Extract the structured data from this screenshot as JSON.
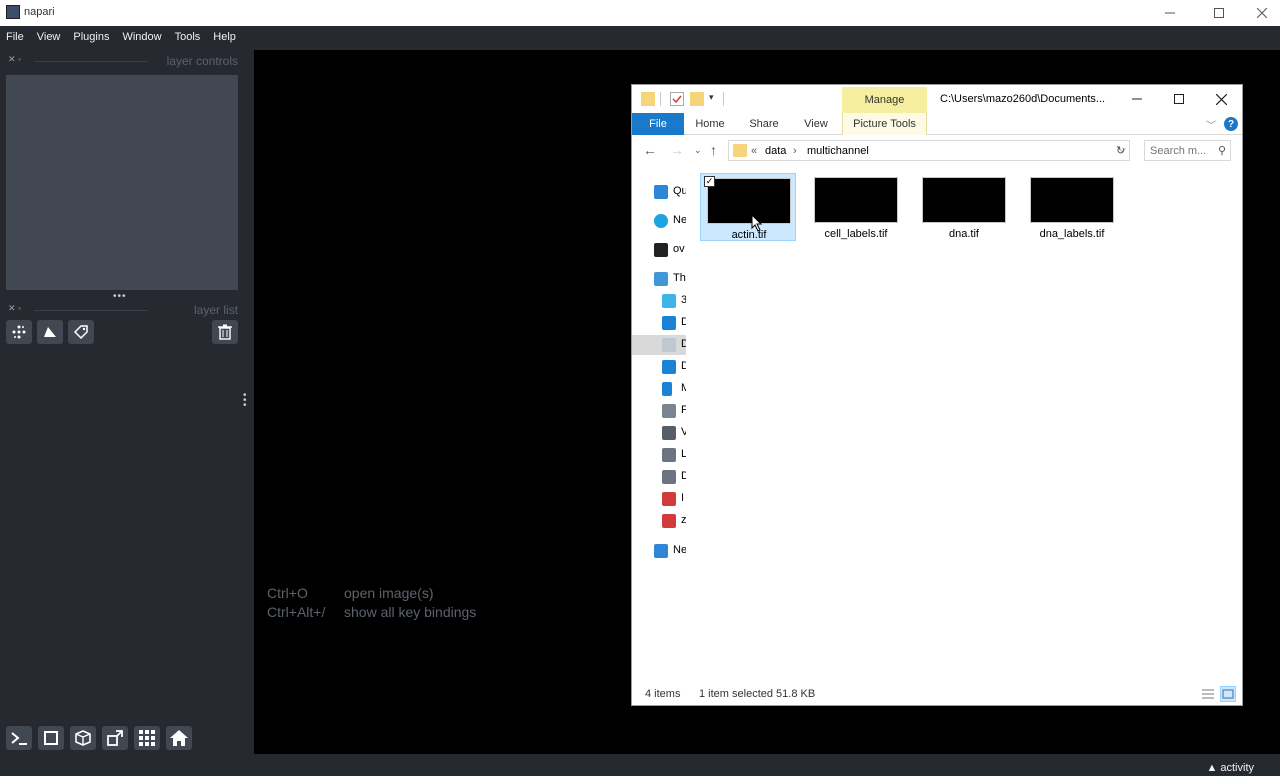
{
  "app": {
    "title": "napari"
  },
  "menu": [
    "File",
    "View",
    "Plugins",
    "Window",
    "Tools",
    "Help"
  ],
  "dock": {
    "layer_controls_title": "layer controls",
    "layer_list_title": "layer list"
  },
  "canvas": {
    "hints": [
      {
        "key": "Ctrl+O",
        "action": "open image(s)"
      },
      {
        "key": "Ctrl+Alt+/",
        "action": "show all key bindings"
      }
    ]
  },
  "status": {
    "activity": "▲ activity"
  },
  "explorer": {
    "title_path": "C:\\Users\\mazo260d\\Documents...",
    "manage_tab": "Manage",
    "tabs": [
      "File",
      "Home",
      "Share",
      "View",
      "Picture Tools"
    ],
    "address": {
      "prefix": "«",
      "segments": [
        "data",
        "multichannel"
      ]
    },
    "search_placeholder": "Search m...",
    "nav_items": [
      {
        "label": "Qu",
        "icon": "star-icon",
        "color": "#2f86d6"
      },
      {
        "label": "Ne",
        "icon": "network-cloud-icon",
        "color": "#1aa3e0"
      },
      {
        "label": "ov",
        "icon": "onedrive-icon",
        "color": "#222222"
      },
      {
        "label": "Th",
        "icon": "pc-icon",
        "color": "#3f97d8"
      },
      {
        "label": "3",
        "icon": "3d-objects-icon",
        "color": "#3fb4e6"
      },
      {
        "label": "D",
        "icon": "desktop-icon",
        "color": "#1b82d6"
      },
      {
        "label": "D",
        "icon": "documents-icon",
        "color": "#bfc7d1"
      },
      {
        "label": "D",
        "icon": "downloads-icon",
        "color": "#1b82d6"
      },
      {
        "label": "M",
        "icon": "music-icon",
        "color": "#1b82d6"
      },
      {
        "label": "P",
        "icon": "pictures-icon",
        "color": "#7a8591"
      },
      {
        "label": "V",
        "icon": "videos-icon",
        "color": "#555e68"
      },
      {
        "label": "L",
        "icon": "local-disk-icon",
        "color": "#6b7480"
      },
      {
        "label": "D",
        "icon": "drive-icon",
        "color": "#6b7480"
      },
      {
        "label": "I",
        "icon": "network-drive-icon",
        "color": "#d23b3b"
      },
      {
        "label": "z",
        "icon": "network-drive-icon",
        "color": "#d23b3b"
      },
      {
        "label": "Ne",
        "icon": "network-icon",
        "color": "#2f86d6"
      }
    ],
    "files": [
      {
        "name": "actin.tif",
        "selected": true
      },
      {
        "name": "cell_labels.tif",
        "selected": false
      },
      {
        "name": "dna.tif",
        "selected": false
      },
      {
        "name": "dna_labels.tif",
        "selected": false
      }
    ],
    "status": {
      "count": "4 items",
      "selection": "1 item selected  51.8 KB"
    }
  }
}
